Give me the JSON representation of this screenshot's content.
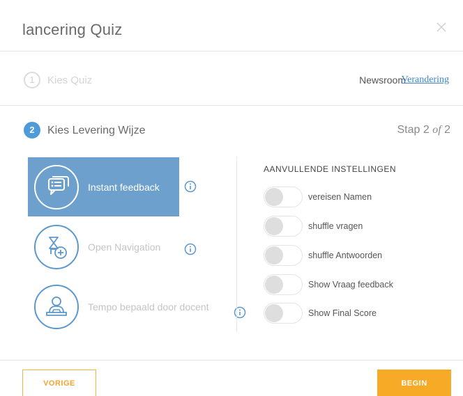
{
  "modal": {
    "title": "lancering Quiz",
    "close_icon": "close-icon"
  },
  "step1": {
    "number": "1",
    "label": "Kies Quiz",
    "selected_quiz": "Newsroom",
    "change_label": "Verandering"
  },
  "step2": {
    "number": "2",
    "label": "Kies Levering Wijze",
    "progress_prefix": "Stap 2 ",
    "progress_of": "of",
    "progress_suffix": " 2",
    "options": [
      {
        "label": "Instant feedback",
        "icon": "feedback-chat-icon",
        "selected": true
      },
      {
        "label": "Open Navigation",
        "icon": "navigation-icon",
        "selected": false
      },
      {
        "label": "Tempo bepaald door docent",
        "icon": "teacher-icon",
        "selected": false
      }
    ]
  },
  "settings": {
    "title": "AANVULLENDE INSTELLINGEN",
    "toggles": [
      {
        "label": "vereisen Namen",
        "on": false
      },
      {
        "label": "shuffle vragen",
        "on": false
      },
      {
        "label": "shuffle Antwoorden",
        "on": false
      },
      {
        "label": "Show Vraag feedback",
        "on": false
      },
      {
        "label": "Show Final Score",
        "on": false
      }
    ]
  },
  "footer": {
    "prev_label": "VORIGE",
    "begin_label": "BEGIN"
  },
  "colors": {
    "accent_blue": "#4f9ad8",
    "selected_bg": "#6da0cc",
    "orange": "#f7aa26",
    "link_blue": "#3f86c8"
  }
}
